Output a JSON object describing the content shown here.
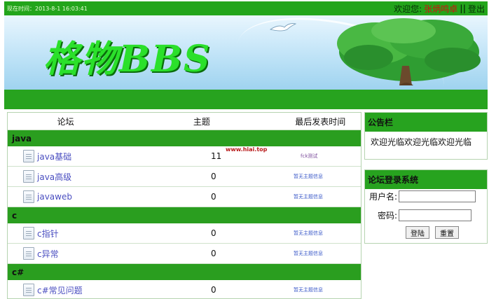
{
  "topbar": {
    "time_text": "现在时间：2013-8-1 16:03:41",
    "welcome_label": "欢迎您:",
    "username": "张炳鸣卓",
    "separator": "||",
    "logout_label": "登出"
  },
  "banner": {
    "logo_text": "格物BBS"
  },
  "forum": {
    "headers": {
      "forum": "论坛",
      "topics": "主题",
      "last_post": "最后发表时间"
    },
    "categories": [
      {
        "name": "java",
        "boards": [
          {
            "name": "java基础",
            "topics": "11",
            "last": "fck测试"
          },
          {
            "name": "java高级",
            "topics": "0",
            "last": "暂无主题信息"
          },
          {
            "name": "javaweb",
            "topics": "0",
            "last": "暂无主题信息"
          }
        ]
      },
      {
        "name": "c",
        "boards": [
          {
            "name": "c指针",
            "topics": "0",
            "last": "暂无主题信息"
          },
          {
            "name": "c异常",
            "topics": "0",
            "last": "暂无主题信息"
          }
        ]
      },
      {
        "name": "c#",
        "boards": [
          {
            "name": "c#常见问题",
            "topics": "0",
            "last": "暂无主题信息"
          }
        ]
      }
    ]
  },
  "watermark": "www.hiai.top",
  "notice": {
    "title": "公告栏",
    "text": "欢迎光临欢迎光临欢迎光临"
  },
  "login": {
    "title": "论坛登录系统",
    "username_label": "用户名:",
    "password_label": "密码:",
    "username_value": "",
    "password_value": "",
    "login_button": "登陆",
    "reset_button": "重置"
  },
  "colors": {
    "primary_green": "#27a31f",
    "link_blue": "#4a4ec0",
    "user_red": "#d10f0f"
  }
}
